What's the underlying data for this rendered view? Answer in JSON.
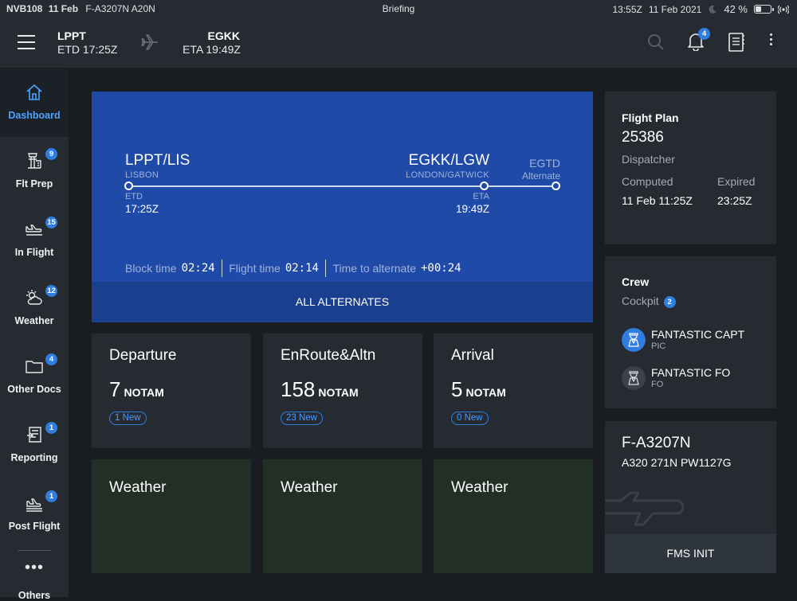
{
  "status_bar": {
    "left_bold": "NVB108",
    "date_bold": "11 Feb",
    "aircraft_info": "F-A3207N A20N",
    "center": "Briefing",
    "time": "13:55Z",
    "date": "11 Feb 2021",
    "battery": "42 %",
    "battery_level": 0.42
  },
  "header": {
    "dep_code": "LPPT",
    "dep_time": "ETD 17:25Z",
    "arr_code": "EGKK",
    "arr_time": "ETA 19:49Z",
    "bell_badge": "4",
    "icons": [
      "menu-icon",
      "plane-icon",
      "search-icon",
      "bell-icon",
      "document-icon",
      "more-icon"
    ]
  },
  "sidebar": {
    "items": [
      {
        "label": "Dashboard",
        "badge": "",
        "icon": "home-icon"
      },
      {
        "label": "Flt Prep",
        "badge": "9",
        "icon": "tower-icon"
      },
      {
        "label": "In Flight",
        "badge": "15",
        "icon": "plane-icon"
      },
      {
        "label": "Weather",
        "badge": "12",
        "icon": "weather-icon"
      },
      {
        "label": "Other Docs",
        "badge": "4",
        "icon": "folder-icon"
      },
      {
        "label": "Reporting",
        "badge": "1",
        "icon": "report-icon"
      },
      {
        "label": "Post Flight",
        "badge": "1",
        "icon": "landing-icon"
      }
    ],
    "more_label": "Others",
    "more_dots": "•••"
  },
  "route": {
    "dep_code": "LPPT/LIS",
    "dep_name": "LISBON",
    "arr_code": "EGKK/LGW",
    "arr_name": "LONDON/GATWICK",
    "alt_code": "EGTD",
    "alt_label": "Alternate",
    "etd_label": "ETD",
    "etd_time": "17:25Z",
    "eta_label": "ETA",
    "eta_time": "19:49Z",
    "block_label": "Block time",
    "block_value": "02:24",
    "flight_label": "Flight time",
    "flight_value": "02:14",
    "alt_time_label": "Time to alternate",
    "alt_time_value": "+00:24",
    "all_alternates": "ALL ALTERNATES"
  },
  "flight_plan": {
    "title": "Flight Plan",
    "number": "25386",
    "role": "Dispatcher",
    "computed_label": "Computed",
    "computed_value": "11 Feb 11:25Z",
    "expired_label": "Expired",
    "expired_value": "23:25Z"
  },
  "crew": {
    "title": "Crew",
    "cockpit_label": "Cockpit",
    "cockpit_count": "2",
    "members": [
      {
        "name": "FANTASTIC CAPT",
        "role": "PIC"
      },
      {
        "name": "FANTASTIC FO",
        "role": "FO"
      }
    ]
  },
  "aircraft": {
    "registration": "F-A3207N",
    "type": "A320 271N PW1127G",
    "fms_init": "FMS INIT"
  },
  "notams": [
    {
      "title": "Departure",
      "count": "7",
      "unit": "NOTAM",
      "new": "1 New"
    },
    {
      "title": "EnRoute&Altn",
      "count": "158",
      "unit": "NOTAM",
      "new": "23 New"
    },
    {
      "title": "Arrival",
      "count": "5",
      "unit": "NOTAM",
      "new": "0 New"
    }
  ],
  "weather_cards": [
    {
      "title": "Weather"
    },
    {
      "title": "Weather"
    },
    {
      "title": "Weather"
    }
  ],
  "colors": {
    "accent": "#2f7de1",
    "route_card": "#1f4aa8",
    "weather_card": "#222f26",
    "panel": "#262b32",
    "background": "#191d22"
  }
}
